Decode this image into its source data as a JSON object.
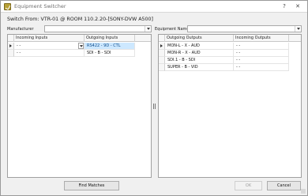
{
  "window": {
    "title": "Equipment Switcher",
    "help_label": "?",
    "close_label": "✕"
  },
  "switch_from": "Switch From: VTR-01 @ ROOM 110.2.20-[SONY-DVW A500]",
  "filters": {
    "manufacturer_label": "Manufacturer",
    "manufacturer_value": "",
    "equipment_name_label": "Equipment Name",
    "equipment_name_value": ""
  },
  "inputs_grid": {
    "columns": [
      "Incoming Inputs",
      "Outgoing Inputs"
    ],
    "rows": [
      {
        "incoming": "- -",
        "outgoing": "RS422 - 9D - CTL",
        "current": true
      },
      {
        "incoming": "- -",
        "outgoing": "SDI - B - SDI",
        "current": false
      }
    ]
  },
  "outputs_grid": {
    "columns": [
      "Outgoing Outputs",
      "Incoming Outputs"
    ],
    "rows": [
      {
        "outgoing": "MON-L - X - AUD",
        "incoming": "- -",
        "current": true
      },
      {
        "outgoing": "MON-R - X - AUD",
        "incoming": "- -",
        "current": false
      },
      {
        "outgoing": "SDI.1 - B - SDI",
        "incoming": "- -",
        "current": false
      },
      {
        "outgoing": "SUPER - B - VID",
        "incoming": "- -",
        "current": false
      }
    ]
  },
  "buttons": {
    "find_matches": "Find Matches",
    "ok": "OK",
    "cancel": "Cancel"
  },
  "colors": {
    "selected_cell": "#cde8ff",
    "window_bg": "#f0f0f0"
  }
}
